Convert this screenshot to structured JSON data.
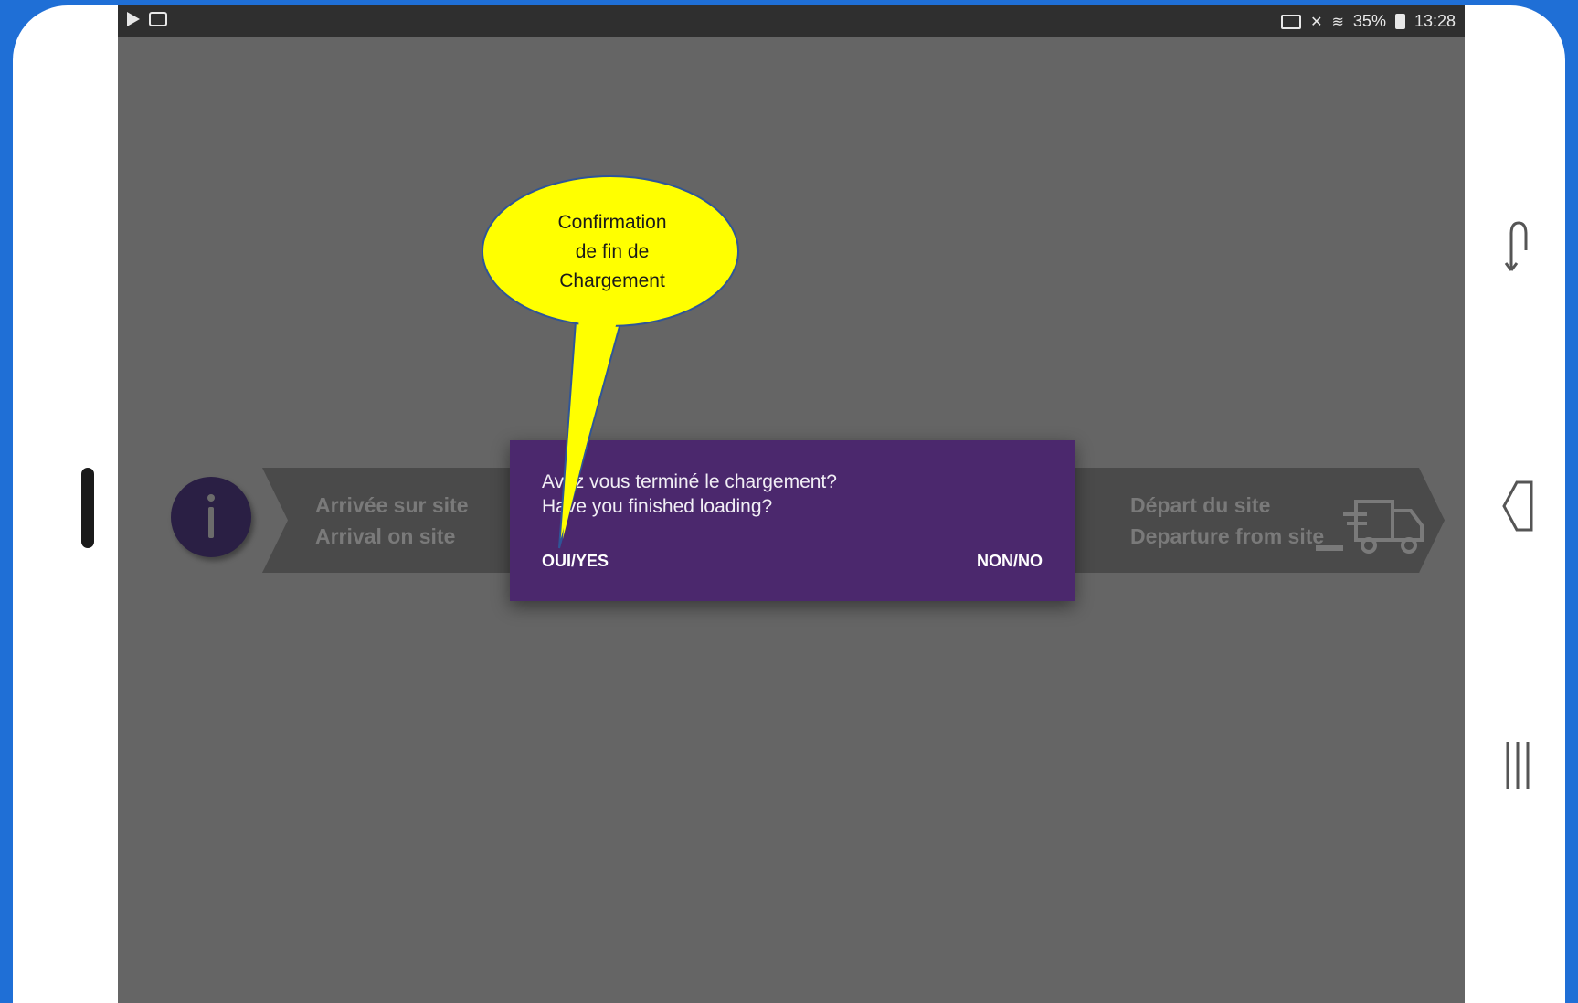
{
  "statusbar": {
    "battery": "35%",
    "time": "13:28"
  },
  "steps": {
    "arrival_fr": "Arrivée sur site",
    "arrival_en": "Arrival on site",
    "departure_fr": "Départ du site",
    "departure_en": "Departure from site"
  },
  "dialog": {
    "message_fr": "Avez vous terminé le chargement?",
    "message_en": "Have you finished loading?",
    "yes_label": "OUI/YES",
    "no_label": "NON/NO"
  },
  "callout": {
    "line1": "Confirmation",
    "line2": "de fin de",
    "line3": "Chargement"
  },
  "colors": {
    "dialog_bg": "#4b286d",
    "callout_fill": "#ffff00",
    "screen_dim": "#656565"
  },
  "icons": {
    "nav_recent": "recent-apps-icon",
    "nav_back": "back-icon",
    "nav_home": "home-lines-icon"
  }
}
